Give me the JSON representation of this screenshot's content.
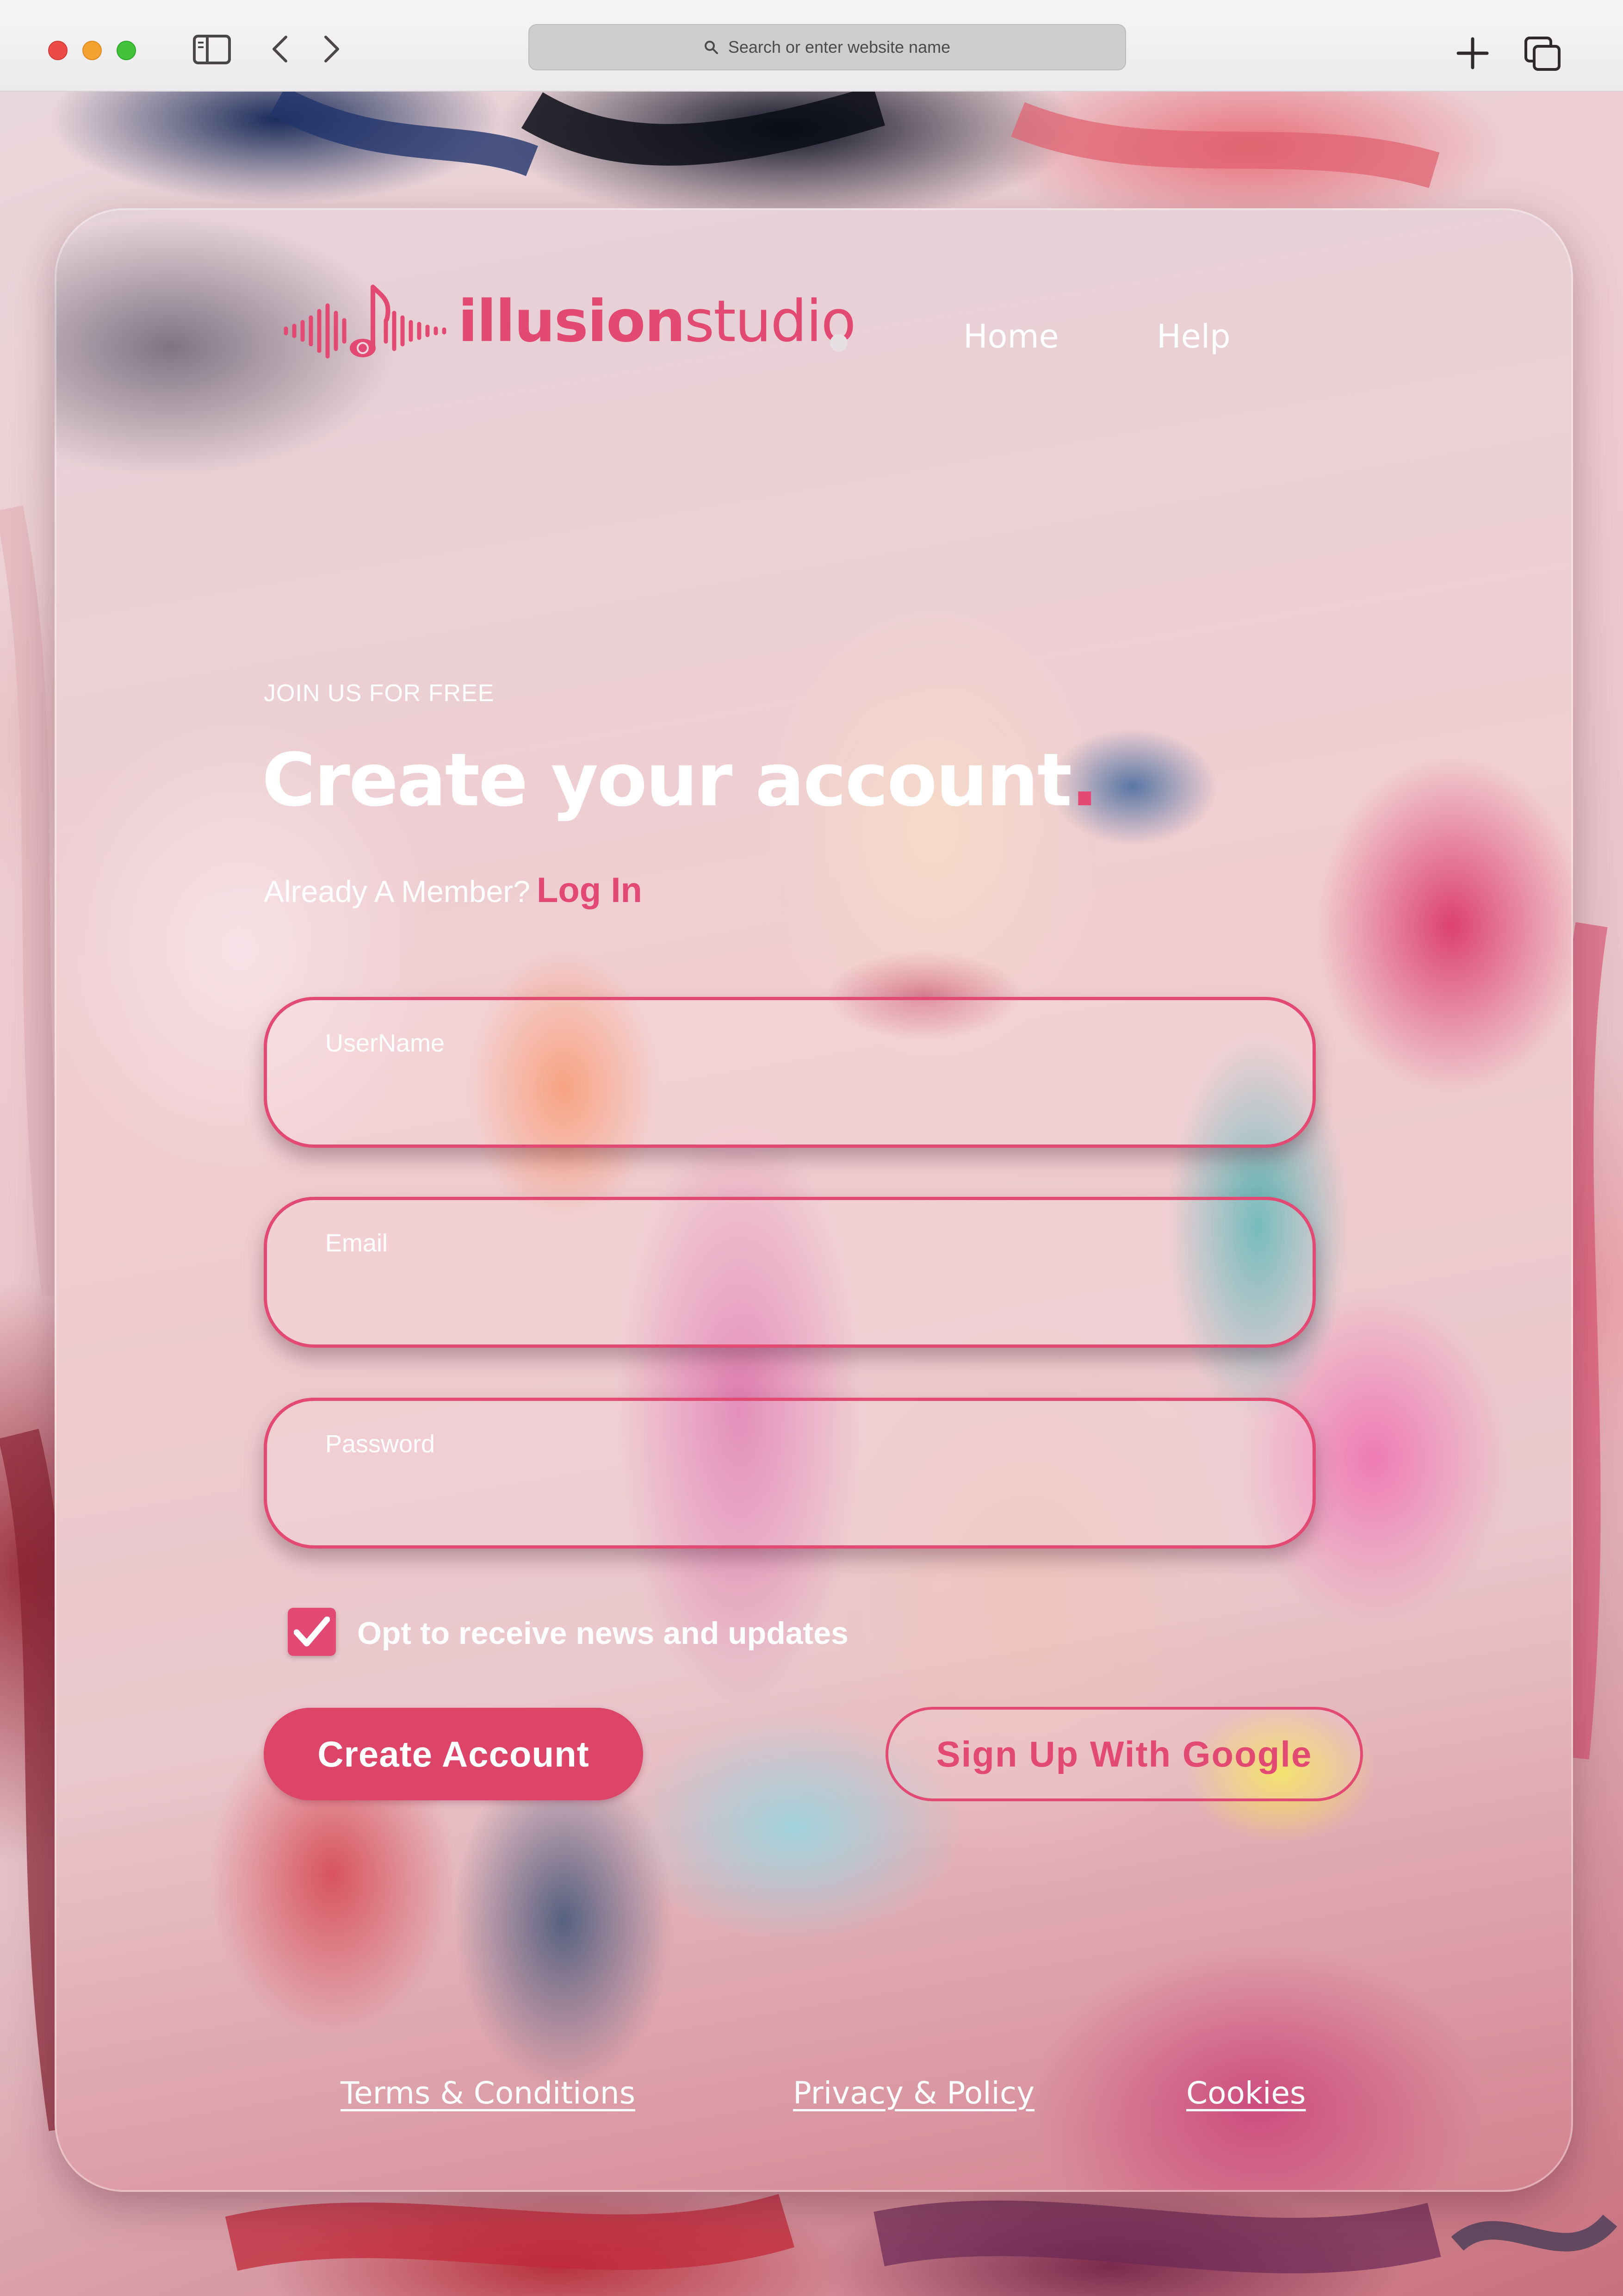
{
  "browser": {
    "address_placeholder": "Search or enter website name"
  },
  "brand": {
    "name_bold": "illusion",
    "name_light": "studio",
    "color": "#e24a73"
  },
  "nav": {
    "home": "Home",
    "help": "Help"
  },
  "signup": {
    "eyebrow": "JOIN US FOR FREE",
    "headline": "Create your account",
    "headline_accent": ".",
    "member_prompt": "Already A Member?",
    "login_link": "Log In"
  },
  "form": {
    "username": {
      "label": "UserName",
      "value": ""
    },
    "email": {
      "label": "Email",
      "value": ""
    },
    "password": {
      "label": "Password",
      "value": ""
    },
    "opt_in": {
      "label": "Opt to receive news and updates",
      "checked": true
    },
    "create_button": "Create Account",
    "google_button": "Sign Up With Google"
  },
  "footer": {
    "terms": "Terms & Conditions",
    "privacy": "Privacy & Policy",
    "cookies": "Cookies"
  }
}
